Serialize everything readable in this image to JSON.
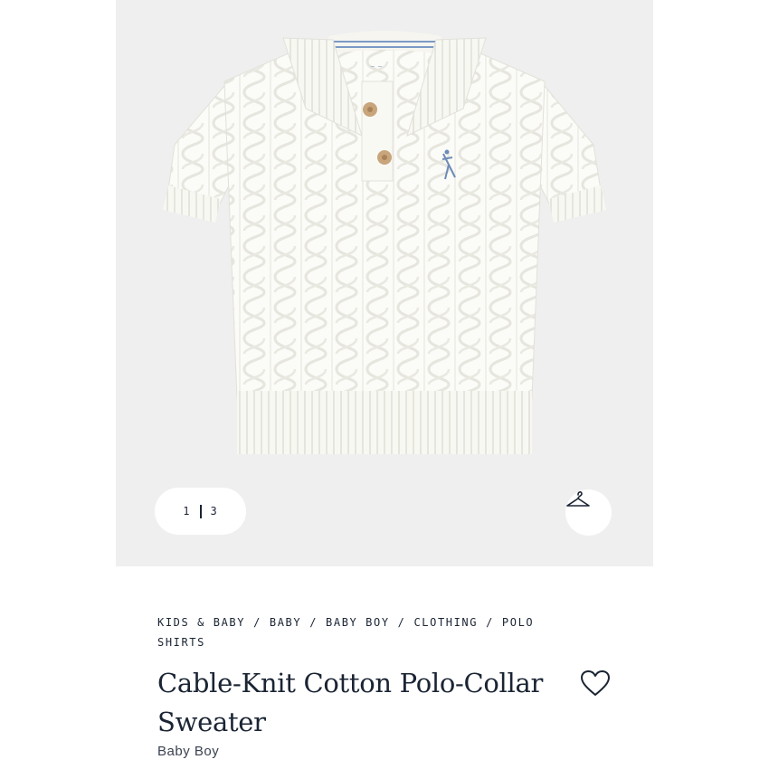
{
  "gallery": {
    "current": "1",
    "total": "3",
    "hanger_icon": "hanger-icon",
    "image_subject": "white cable-knit polo sweater"
  },
  "breadcrumb": [
    "KIDS & BABY",
    "BABY",
    "BABY BOY",
    "CLOTHING",
    "POLO SHIRTS"
  ],
  "product": {
    "title": "Cable-Knit Cotton Polo-Collar Sweater",
    "subtitle": "Baby Boy",
    "favorite_icon": "heart-icon"
  },
  "colors": {
    "hero_bg": "#efefef",
    "text_navy": "#1a2433",
    "sweater": "#fbfbf7",
    "logo_blue": "#6d8bb8"
  }
}
